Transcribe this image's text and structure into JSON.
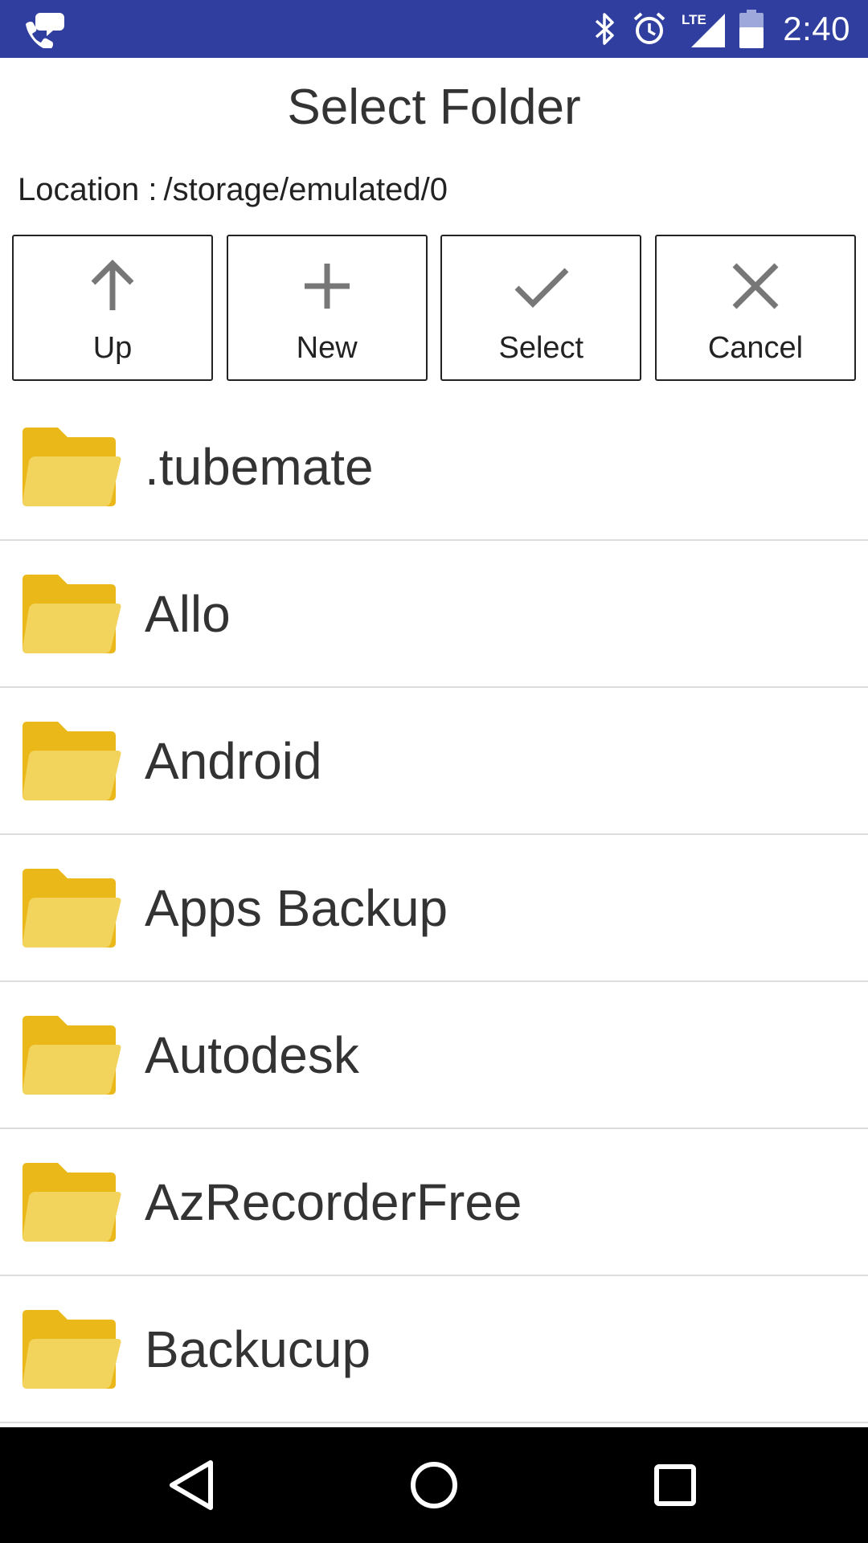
{
  "status_bar": {
    "time": "2:40",
    "network_label": "LTE",
    "bg_color": "#303f9f",
    "icons": [
      "call-chat-icon",
      "bluetooth-icon",
      "alarm-icon",
      "lte-signal-icon",
      "battery-icon"
    ]
  },
  "dialog": {
    "title": "Select Folder",
    "location_label": "Location :",
    "location_value": "/storage/emulated/0"
  },
  "toolbar": {
    "buttons": [
      {
        "label": "Up",
        "icon": "arrow-up-icon"
      },
      {
        "label": "New",
        "icon": "plus-icon"
      },
      {
        "label": "Select",
        "icon": "check-icon"
      },
      {
        "label": "Cancel",
        "icon": "close-icon"
      }
    ]
  },
  "folders": [
    {
      "name": ".tubemate"
    },
    {
      "name": "Allo"
    },
    {
      "name": "Android"
    },
    {
      "name": "Apps Backup"
    },
    {
      "name": "Autodesk"
    },
    {
      "name": "AzRecorderFree"
    },
    {
      "name": "Backucup"
    }
  ],
  "colors": {
    "folder_back": "#ebb81a",
    "folder_front": "#f2d35c",
    "divider": "#dddddd"
  },
  "nav_bar": {
    "icons": [
      "back-icon",
      "home-icon",
      "recents-icon"
    ]
  }
}
